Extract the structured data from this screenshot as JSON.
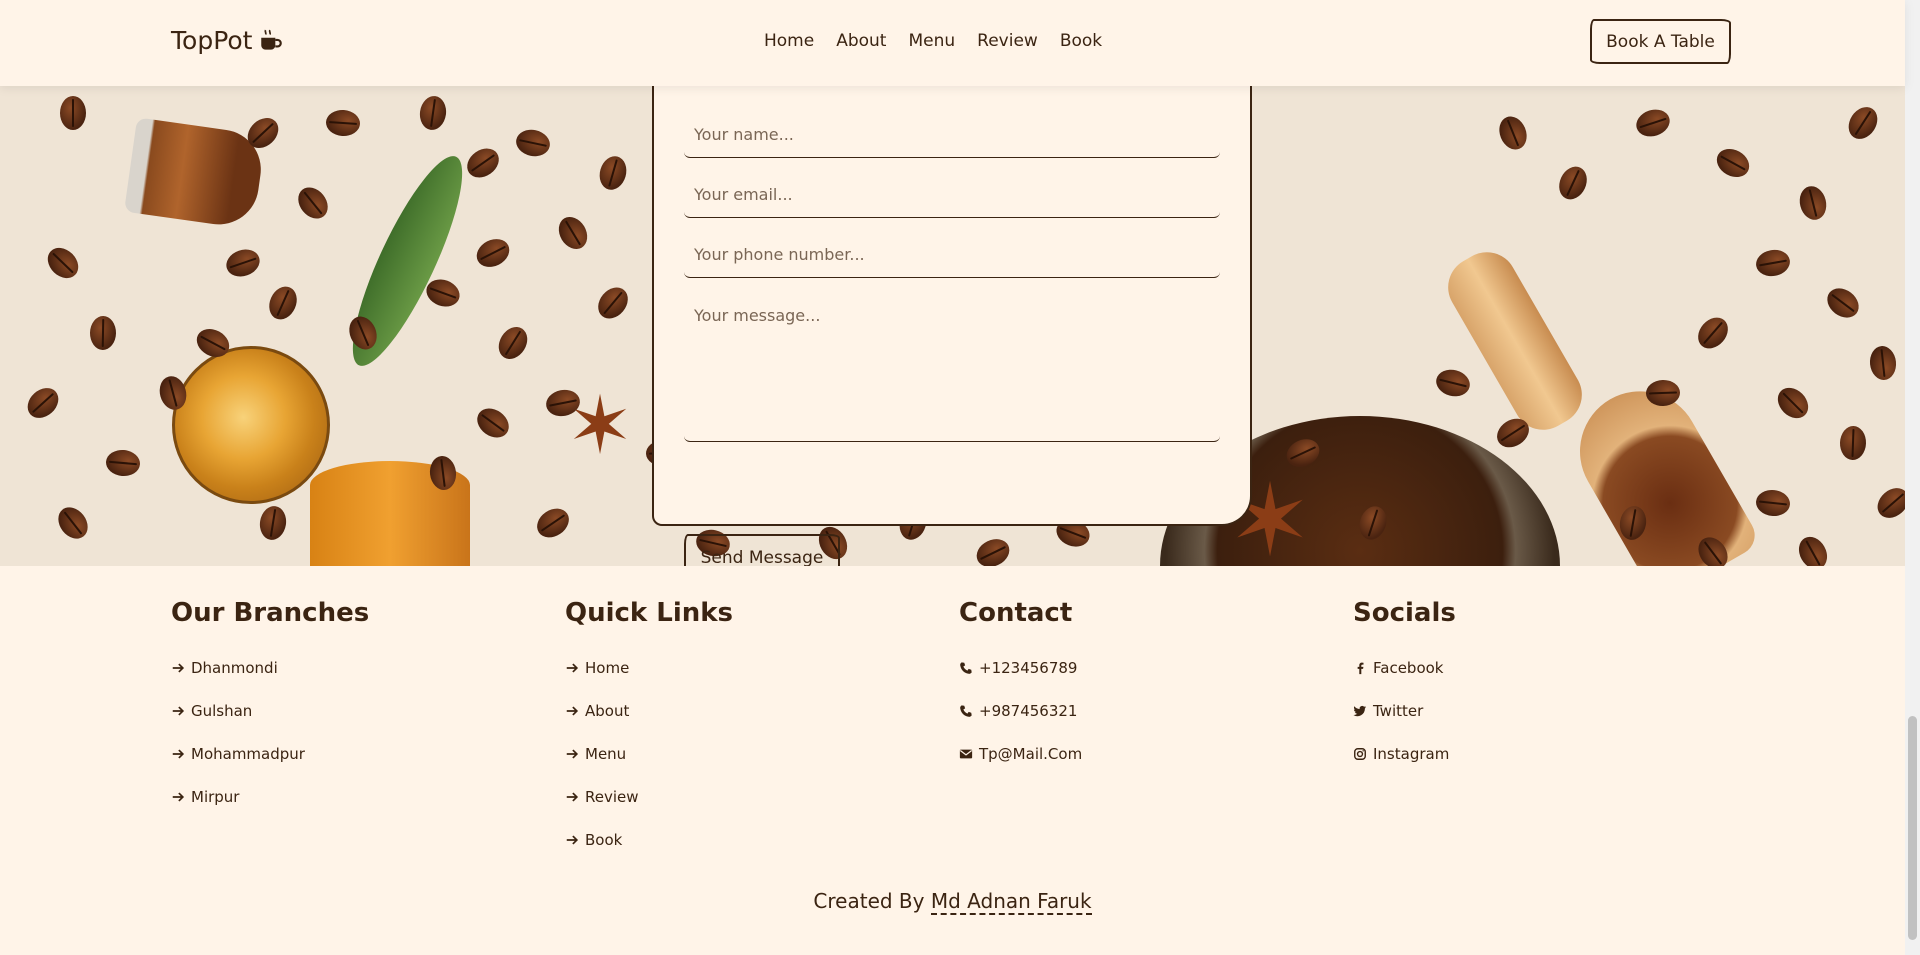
{
  "header": {
    "logo_text": "TopPot",
    "logo_icon": "mug-hot-icon",
    "nav": [
      "Home",
      "About",
      "Menu",
      "Review",
      "Book"
    ],
    "cta": "Book A Table"
  },
  "contact_form": {
    "name_placeholder": "Your name...",
    "email_placeholder": "Your email...",
    "phone_placeholder": "Your phone number...",
    "message_placeholder": "Your message...",
    "submit_label": "Send Message"
  },
  "footer": {
    "branches": {
      "title": "Our Branches",
      "items": [
        "Dhanmondi",
        "Gulshan",
        "Mohammadpur",
        "Mirpur"
      ]
    },
    "quick_links": {
      "title": "Quick Links",
      "items": [
        "Home",
        "About",
        "Menu",
        "Review",
        "Book"
      ]
    },
    "contact": {
      "title": "Contact",
      "items": [
        {
          "icon": "phone-icon",
          "text": "+123456789"
        },
        {
          "icon": "phone-icon",
          "text": "+987456321"
        },
        {
          "icon": "envelope-icon",
          "text": "Tp@Mail.Com"
        }
      ]
    },
    "socials": {
      "title": "Socials",
      "items": [
        {
          "icon": "facebook-icon",
          "text": "Facebook"
        },
        {
          "icon": "twitter-icon",
          "text": "Twitter"
        },
        {
          "icon": "instagram-icon",
          "text": "Instagram"
        }
      ]
    },
    "credit_prefix": "Created By",
    "credit_author": "Md Adnan Faruk"
  },
  "colors": {
    "background": "#fff4e8",
    "text": "#3b2412",
    "hero_bg": "#efe4d5"
  }
}
